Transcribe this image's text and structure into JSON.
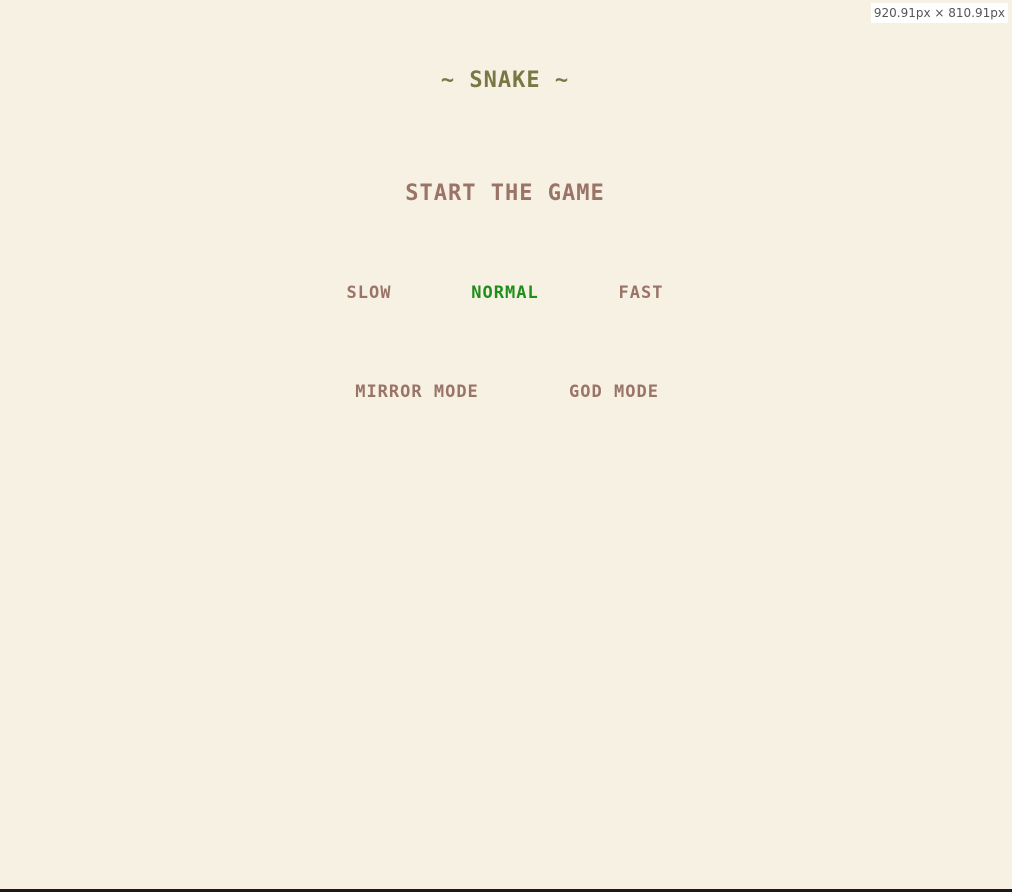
{
  "dimensions_badge": "920.91px × 810.91px",
  "game": {
    "title": "~ SNAKE ~",
    "start_label": "START THE GAME",
    "speed_options": [
      {
        "label": "SLOW",
        "selected": false
      },
      {
        "label": "NORMAL",
        "selected": true
      },
      {
        "label": "FAST",
        "selected": false
      }
    ],
    "mode_options": [
      {
        "label": "MIRROR MODE",
        "selected": false
      },
      {
        "label": "GOD MODE",
        "selected": false
      }
    ]
  },
  "colors": {
    "background": "#f7f1e3",
    "title": "#7b7745",
    "menu_text": "#9b7468",
    "selected": "#1f8f1a"
  }
}
